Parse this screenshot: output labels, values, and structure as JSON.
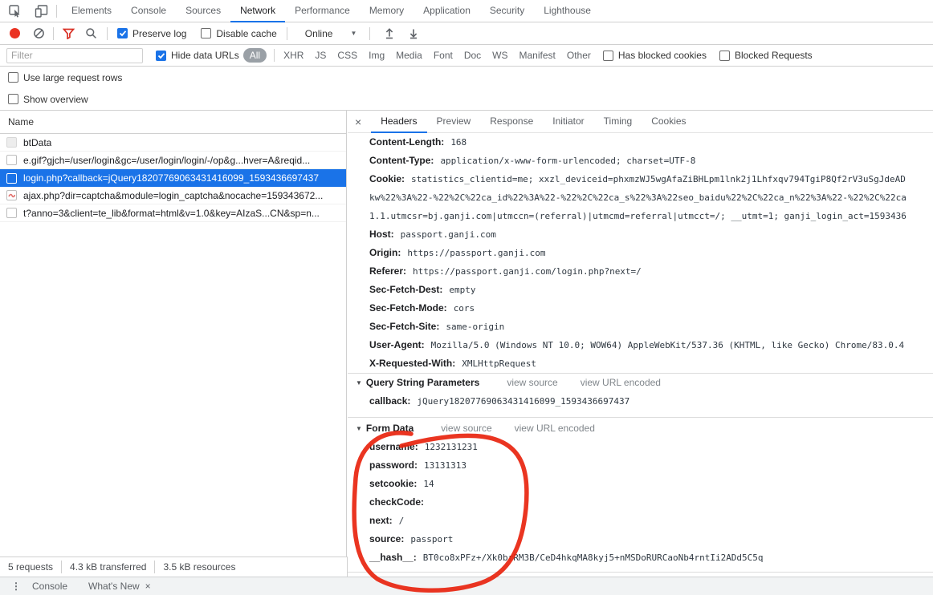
{
  "icons": {
    "disclosure": "▼",
    "close": "×",
    "overflow_menu": "⋮",
    "dropdown_caret": "▼"
  },
  "annotation": {
    "shape": "hand-drawn-circle",
    "color": "#e8240e",
    "target": "Form Data section"
  },
  "colors": {
    "accent_blue": "#1a73e8",
    "selection_blue": "#1a73e8",
    "record_red": "#ea3323",
    "filter_red": "#d93025"
  },
  "main_tabs": {
    "items": [
      "Elements",
      "Console",
      "Sources",
      "Network",
      "Performance",
      "Memory",
      "Application",
      "Security",
      "Lighthouse"
    ],
    "selected": "Network"
  },
  "toolbar": {
    "preserve_log_label": "Preserve log",
    "disable_cache_label": "Disable cache",
    "throttling_value": "Online"
  },
  "filter_bar": {
    "filter_placeholder": "Filter",
    "hide_data_urls_label": "Hide data URLs",
    "types": [
      "All",
      "XHR",
      "JS",
      "CSS",
      "Img",
      "Media",
      "Font",
      "Doc",
      "WS",
      "Manifest",
      "Other"
    ],
    "selected_type": "All",
    "has_blocked_cookies_label": "Has blocked cookies",
    "blocked_requests_label": "Blocked Requests"
  },
  "options": {
    "use_large_request_rows_label": "Use large request rows",
    "show_overview_label": "Show overview"
  },
  "request_list": {
    "name_header": "Name",
    "rows": [
      {
        "name": "btData",
        "selected": false
      },
      {
        "name": "e.gif?gjch=/user/login&gc=/user/login/login/-/op&g...hver=A&reqid...",
        "selected": false
      },
      {
        "name": "login.php?callback=jQuery18207769063431416099_1593436697437",
        "selected": true
      },
      {
        "name": "ajax.php?dir=captcha&module=login_captcha&nocache=159343672...",
        "selected": false
      },
      {
        "name": "t?anno=3&client=te_lib&format=html&v=1.0&key=AIzaS...CN&sp=n...",
        "selected": false
      }
    ]
  },
  "details": {
    "tabs": [
      "Headers",
      "Preview",
      "Response",
      "Initiator",
      "Timing",
      "Cookies"
    ],
    "selected_tab": "Headers",
    "request_headers": [
      {
        "n": "Content-Length:",
        "v": "168"
      },
      {
        "n": "Content-Type:",
        "v": "application/x-www-form-urlencoded; charset=UTF-8"
      },
      {
        "n": "Cookie:",
        "v": "statistics_clientid=me; xxzl_deviceid=phxmzWJ5wgAfaZiBHLpm1lnk2j1Lhfxqv794TgiP8Qf2rV3uSgJdeAD",
        "v2": "kw%22%3A%22-%22%2C%22ca_id%22%3A%22-%22%2C%22ca_s%22%3A%22seo_baidu%22%2C%22ca_n%22%3A%22-%22%2C%22ca",
        "v3": "1.1.utmcsr=bj.ganji.com|utmccn=(referral)|utmcmd=referral|utmcct=/; __utmt=1; ganji_login_act=1593436"
      },
      {
        "n": "Host:",
        "v": "passport.ganji.com"
      },
      {
        "n": "Origin:",
        "v": "https://passport.ganji.com"
      },
      {
        "n": "Referer:",
        "v": "https://passport.ganji.com/login.php?next=/"
      },
      {
        "n": "Sec-Fetch-Dest:",
        "v": "empty"
      },
      {
        "n": "Sec-Fetch-Mode:",
        "v": "cors"
      },
      {
        "n": "Sec-Fetch-Site:",
        "v": "same-origin"
      },
      {
        "n": "User-Agent:",
        "v": "Mozilla/5.0 (Windows NT 10.0; WOW64) AppleWebKit/537.36 (KHTML, like Gecko) Chrome/83.0.4"
      },
      {
        "n": "X-Requested-With:",
        "v": "XMLHttpRequest"
      }
    ],
    "query_section": {
      "title": "Query String Parameters",
      "view_source_label": "view source",
      "view_url_encoded_label": "view URL encoded",
      "params": [
        {
          "n": "callback:",
          "v": "jQuery18207769063431416099_1593436697437"
        }
      ]
    },
    "form_section": {
      "title": "Form Data",
      "view_source_label": "view source",
      "view_url_encoded_label": "view URL encoded",
      "params": [
        {
          "n": "username:",
          "v": "1232131231"
        },
        {
          "n": "password:",
          "v": "13131313"
        },
        {
          "n": "setcookie:",
          "v": "14"
        },
        {
          "n": "checkCode:",
          "v": ""
        },
        {
          "n": "next:",
          "v": "/"
        },
        {
          "n": "source:",
          "v": "passport"
        },
        {
          "n": "__hash__:",
          "v": "BT0co8xPFz+/Xk0brRM3B/CeD4hkqMA8kyj5+nMSDoRURCaoNb4rntIi2ADd5C5q"
        }
      ]
    }
  },
  "status_bar": {
    "requests": "5 requests",
    "transferred": "4.3 kB transferred",
    "resources": "3.5 kB resources"
  },
  "drawer": {
    "tabs": [
      "Console",
      "What's New"
    ]
  }
}
